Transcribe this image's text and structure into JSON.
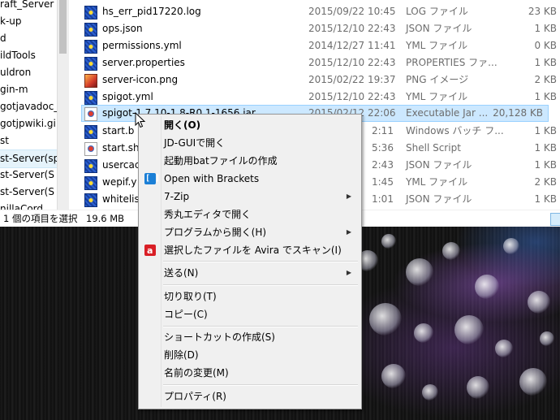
{
  "nav_items": [
    "raft_Server",
    "k-up",
    "d",
    "ildTools",
    "uldron",
    "gin-m",
    "gotjavadoc_",
    "gotjpwiki.gi",
    "st",
    "st-Server(sp",
    "st-Server(S",
    "st-Server(S",
    "nillaCord"
  ],
  "files": [
    {
      "name": "hs_err_pid17220.log",
      "date": "2015/09/22 10:45",
      "type": "LOG ファイル",
      "size": "23 KB",
      "icon": "log-file-icon"
    },
    {
      "name": "ops.json",
      "date": "2015/12/10 22:43",
      "type": "JSON ファイル",
      "size": "1 KB",
      "icon": "json-file-icon"
    },
    {
      "name": "permissions.yml",
      "date": "2014/12/27 11:41",
      "type": "YML ファイル",
      "size": "0 KB",
      "icon": "yml-file-icon"
    },
    {
      "name": "server.properties",
      "date": "2015/12/10 22:43",
      "type": "PROPERTIES ファ...",
      "size": "1 KB",
      "icon": "properties-file-icon"
    },
    {
      "name": "server-icon.png",
      "date": "2015/02/22 19:37",
      "type": "PNG イメージ",
      "size": "2 KB",
      "icon": "png-image-icon"
    },
    {
      "name": "spigot.yml",
      "date": "2015/12/10 22:43",
      "type": "YML ファイル",
      "size": "1 KB",
      "icon": "yml-file-icon"
    },
    {
      "name": "spigot-1.7.10-1.8-R0.1-1656.jar",
      "date": "2015/02/12 22:06",
      "type": "Executable Jar ...",
      "size": "20,128 KB",
      "icon": "jar-file-icon"
    },
    {
      "name": "start.b",
      "date": "2:11",
      "type": "Windows バッチ フ...",
      "size": "1 KB",
      "icon": "batch-file-icon"
    },
    {
      "name": "start.sh",
      "date": "5:36",
      "type": "Shell Script",
      "size": "1 KB",
      "icon": "shell-script-icon"
    },
    {
      "name": "usercac",
      "date": "2:43",
      "type": "JSON ファイル",
      "size": "1 KB",
      "icon": "json-file-icon"
    },
    {
      "name": "wepif.y",
      "date": "1:45",
      "type": "YML ファイル",
      "size": "2 KB",
      "icon": "yml-file-icon"
    },
    {
      "name": "whitelis",
      "date": "1:01",
      "type": "JSON ファイル",
      "size": "1 KB",
      "icon": "json-file-icon"
    }
  ],
  "status": {
    "selection": "1 個の項目を選択",
    "size": "19.6 MB"
  },
  "context_menu": {
    "open": "開く(O)",
    "jdgui": "JD-GUIで開く",
    "create_bat": "起動用batファイルの作成",
    "open_brackets": "Open with Brackets",
    "zip": "7-Zip",
    "hidemaru": "秀丸エディタで開く",
    "open_with": "プログラムから開く(H)",
    "avira_scan": "選択したファイルを Avira でスキャン(I)",
    "send_to": "送る(N)",
    "cut": "切り取り(T)",
    "copy": "コピー(C)",
    "create_shortcut": "ショートカットの作成(S)",
    "delete": "削除(D)",
    "rename": "名前の変更(M)",
    "properties": "プロパティ(R)"
  }
}
